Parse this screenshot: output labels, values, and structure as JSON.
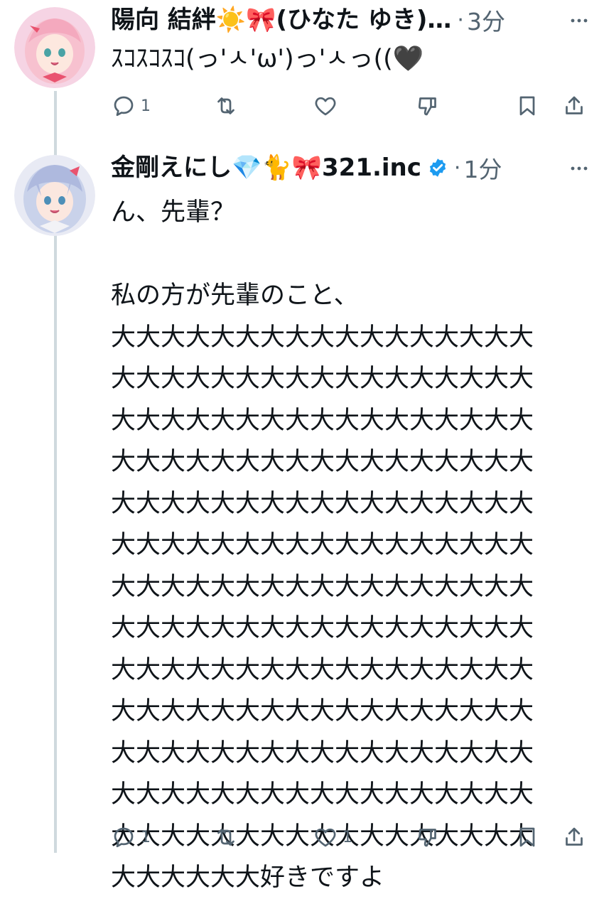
{
  "tweets": [
    {
      "author_name": "陽向 結絆☀️🎀(ひなた ゆき)…",
      "verified": false,
      "dot": "·",
      "time": "3分",
      "text": "ｽｺｽｺｽｺ(っ'ㅅ'ω')っ'ㅅっ((🖤",
      "actions": {
        "replies": "1",
        "retweets": "",
        "likes": "",
        "liked": false
      },
      "avatar_icon": "avatar-pink-hair-girl"
    },
    {
      "author_name": "金剛えにし💎🐈🎀321.inc",
      "verified": true,
      "dot": "·",
      "time": "1分",
      "text": "ん、先輩？\n\n私の方が先輩のこと、\n大大大大大大大大大大大大大大大大大\n大大大大大大大大大大大大大大大大大\n大大大大大大大大大大大大大大大大大\n大大大大大大大大大大大大大大大大大\n大大大大大大大大大大大大大大大大大\n大大大大大大大大大大大大大大大大大\n大大大大大大大大大大大大大大大大大\n大大大大大大大大大大大大大大大大大\n大大大大大大大大大大大大大大大大大\n大大大大大大大大大大大大大大大大大\n大大大大大大大大大大大大大大大大大\n大大大大大大大大大大大大大大大大大\n大大大大大大大大大大大大大大大大大\n大大大大大大好きですよ",
      "actions": {
        "replies": "1",
        "retweets": "",
        "likes": "1",
        "liked": false
      },
      "avatar_icon": "avatar-silver-hair-girl"
    }
  ],
  "icons": {
    "reply": "reply-icon",
    "retweet": "retweet-icon",
    "like": "heart-icon",
    "dislike": "dislike-icon",
    "bookmark": "bookmark-icon",
    "share": "share-icon",
    "more": "more-icon",
    "verified": "verified-badge-icon"
  },
  "colors": {
    "text": "#0f1419",
    "secondary": "#536471",
    "verified": "#1d9bf0",
    "thread_line": "#cfd9de"
  }
}
